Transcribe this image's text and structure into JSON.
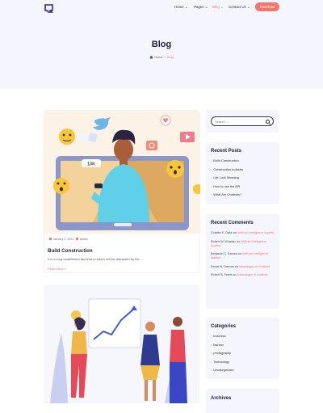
{
  "nav": {
    "home": "Home",
    "pages": "Pages",
    "blog": "Blog",
    "contact": "Contact Us",
    "download": "Download"
  },
  "hero": {
    "title": "Blog",
    "crumb_home": "Home",
    "crumb_current": "Blog"
  },
  "post1": {
    "date": "January 2, 2021",
    "author": "admin",
    "title": "Build Construction",
    "excerpt": "It is a long established fact that a reader will be distracted by the",
    "read_more": "Read More »",
    "image_badge": "13K"
  },
  "sidebar": {
    "search_placeholder": "Search ...",
    "recent_posts_title": "Recent Posts",
    "recent_posts": [
      "Build Construction",
      "Construction Industry",
      "Life Lock Meaning",
      "How to use the API",
      "What Are Chatbots?"
    ],
    "recent_comments_title": "Recent Comments",
    "comments": [
      {
        "author": "Charles K. Dyke",
        "on": "on",
        "post": "Artificial Intelligence Applied"
      },
      {
        "author": "Robert W. Winship",
        "on": "on",
        "post": "Artificial Intelligence Applied"
      },
      {
        "author": "Benjamin C. Barnes",
        "on": "on",
        "post": "Artificial Intelligence Applied"
      },
      {
        "author": "Daniel N. Dancos",
        "on": "on",
        "post": "Advantages of chatbots"
      },
      {
        "author": "Robert B. Ferrel",
        "on": "on",
        "post": "Advantages of chatbots"
      }
    ],
    "categories_title": "Categories",
    "categories": [
      "business",
      "fashion",
      "photography",
      "Technology",
      "Uncategorized"
    ],
    "archives_title": "Archives"
  },
  "colors": {
    "accent": "#f4766a",
    "hero_bg": "#f4f5fd",
    "dark": "#1e1e36"
  }
}
